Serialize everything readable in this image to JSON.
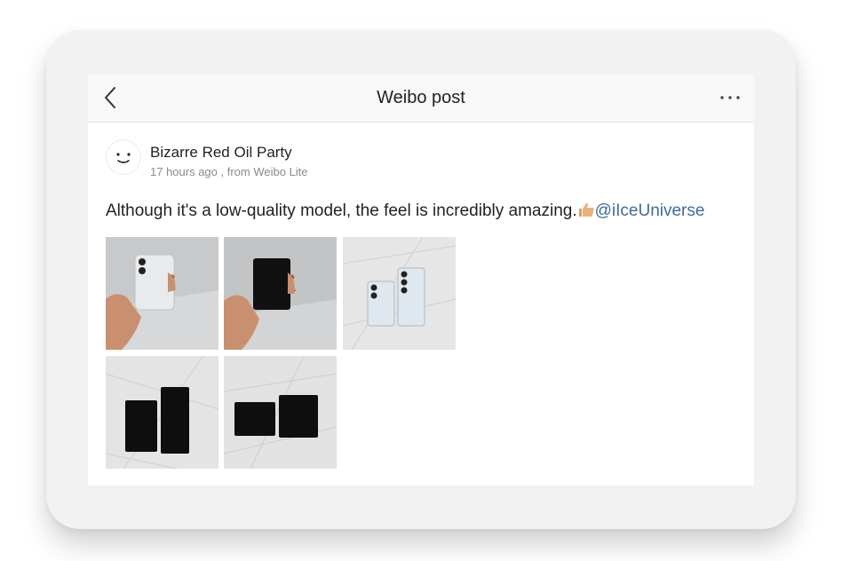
{
  "header": {
    "title": "Weibo post",
    "back_icon": "chevron-left-icon",
    "more_icon": "ellipsis-icon"
  },
  "post": {
    "author": "Bizarre Red Oil Party",
    "meta": "17 hours ago , from Weibo Lite",
    "text": "Although it's a low-quality model, the feel is incredibly amazing.",
    "emoji": "thumbs-up-emoji",
    "mention": "@iIceUniverse",
    "photos": [
      {
        "id": 1,
        "subject": "hand holding silver phone"
      },
      {
        "id": 2,
        "subject": "hand holding black phone"
      },
      {
        "id": 3,
        "subject": "two silver phones on marble"
      },
      {
        "id": 4,
        "subject": "two black phones on marble"
      },
      {
        "id": 5,
        "subject": "black phones on marble"
      }
    ]
  },
  "colors": {
    "link": "#3d6b9a",
    "frame": "#f2f2f2",
    "topbar": "#f8f8f8"
  }
}
